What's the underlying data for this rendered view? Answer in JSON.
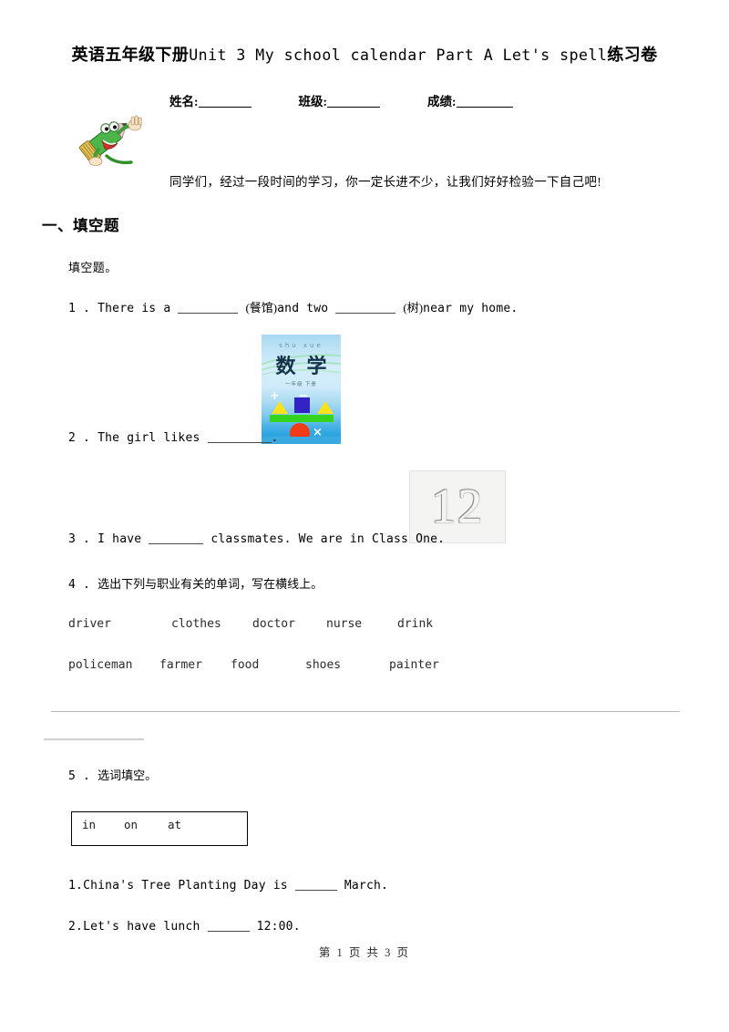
{
  "document": {
    "title_cn_prefix": "英语五年级下册",
    "title_en": "Unit 3 My school calendar Part A Let's spell",
    "title_cn_suffix": "练习卷"
  },
  "info_row": {
    "name_label": "姓名:",
    "class_label": "班级:",
    "score_label": "成绩:",
    "name_value": "",
    "class_value": "",
    "score_value": ""
  },
  "mascot": {
    "icon": "cartoon-crocodile-pencil-icon",
    "colors": {
      "body_green": "#3fae3a",
      "hat_tan": "#e0c060",
      "accent_pink": "#f2b8c6"
    }
  },
  "intro": {
    "text": "同学们，经过一段时间的学习，你一定长进不少，让我们好好检验一下自己吧!"
  },
  "section": {
    "heading": "一、填空题",
    "subheading": "填空题。"
  },
  "questions": {
    "q1": {
      "number": "1 .",
      "part_a": "There is a",
      "hint_a": "(餐馆)",
      "part_b": "and two",
      "hint_b": "(树)",
      "part_c": "near my home."
    },
    "q2": {
      "number": "2 .",
      "text": "The girl likes",
      "tail": "."
    },
    "q3": {
      "number": "3 .",
      "part_a": "I have",
      "part_b": "classmates. We are in Class One."
    },
    "q4": {
      "number": "4 .",
      "text": "选出下列与职业有关的单词，写在横线上。",
      "words_row1": [
        "driver",
        "clothes",
        "doctor",
        "nurse",
        "drink"
      ],
      "words_row2": [
        "policeman",
        "farmer",
        "food",
        "shoes",
        "painter"
      ]
    },
    "q5": {
      "number": "5 .",
      "text": "选词填空。",
      "word_bank": [
        "in",
        "on",
        "at"
      ],
      "sub": [
        {
          "number": "1.",
          "part_a": "China's Tree Planting Day is",
          "part_b": "March."
        },
        {
          "number": "2.",
          "part_a": "Let's have lunch",
          "part_b": "12:00."
        }
      ]
    }
  },
  "images": {
    "math_book": {
      "pinyin": "shu    xue",
      "title": "数学",
      "subtitle": "一年级    下册",
      "ops_top": "+ −",
      "ops_bottom": "× +",
      "alt": "math-textbook-cover"
    },
    "number_plate": {
      "value": "12",
      "alt": "embossed-number-twelve"
    }
  },
  "footer": {
    "text": "第 1 页 共 3 页"
  }
}
